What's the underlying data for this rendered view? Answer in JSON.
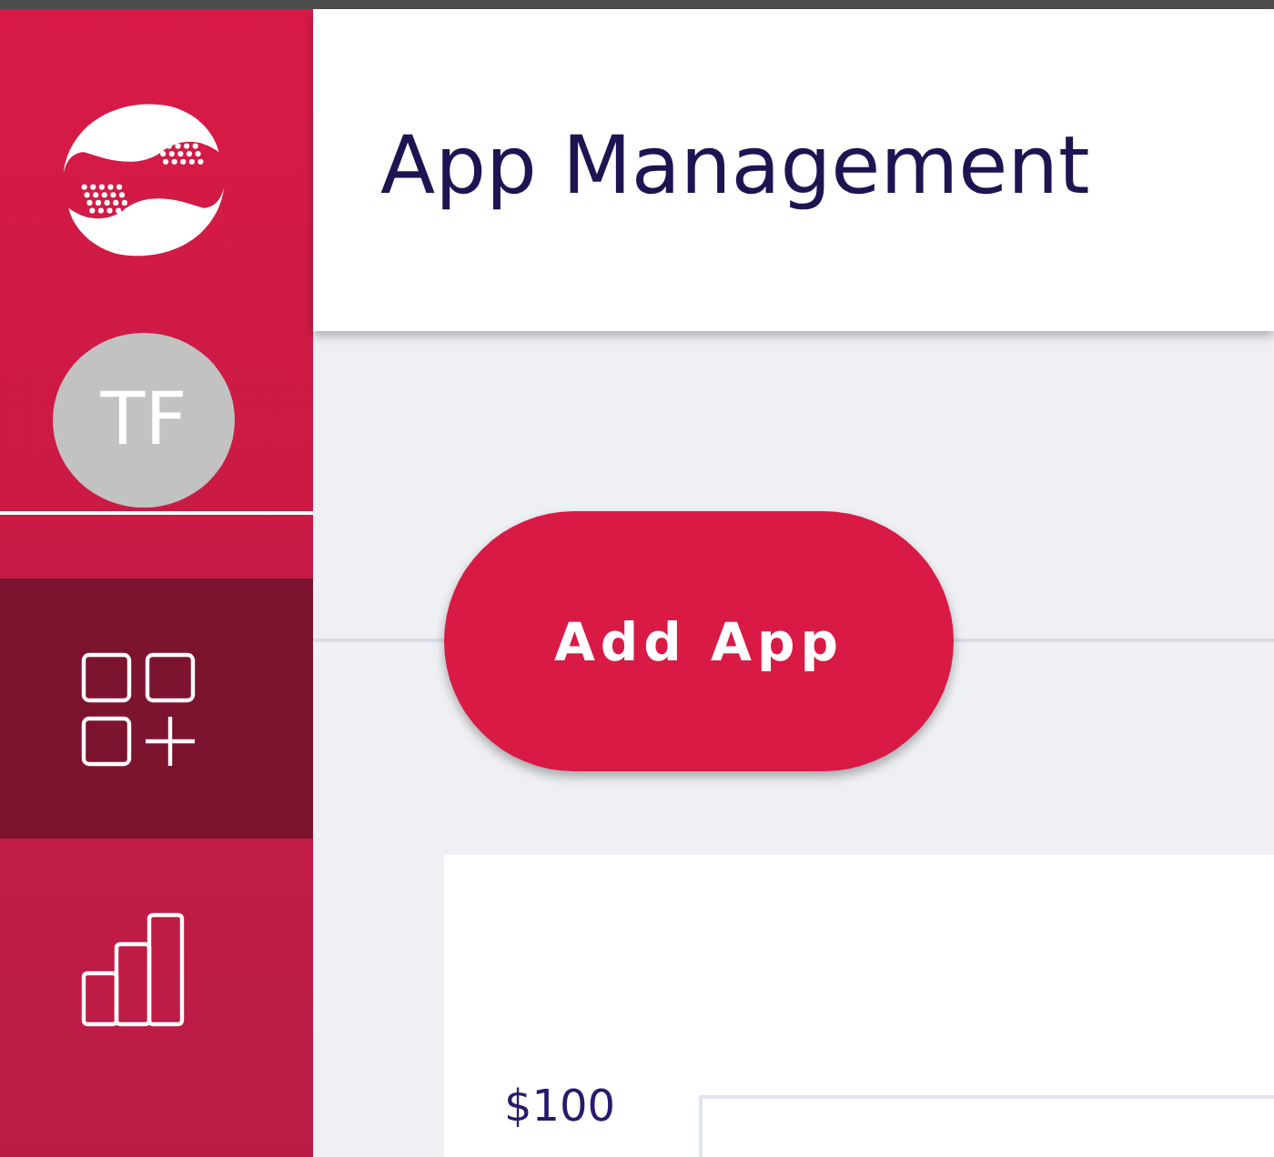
{
  "sidebar": {
    "avatar": {
      "initials": "TF"
    },
    "items": [
      {
        "kind": "apps",
        "selected": true
      },
      {
        "kind": "stats",
        "selected": false
      }
    ]
  },
  "header": {
    "title": "App Management"
  },
  "toolbar": {
    "add_button": "Add App"
  },
  "card": {
    "y_axis_label": "$100"
  }
}
